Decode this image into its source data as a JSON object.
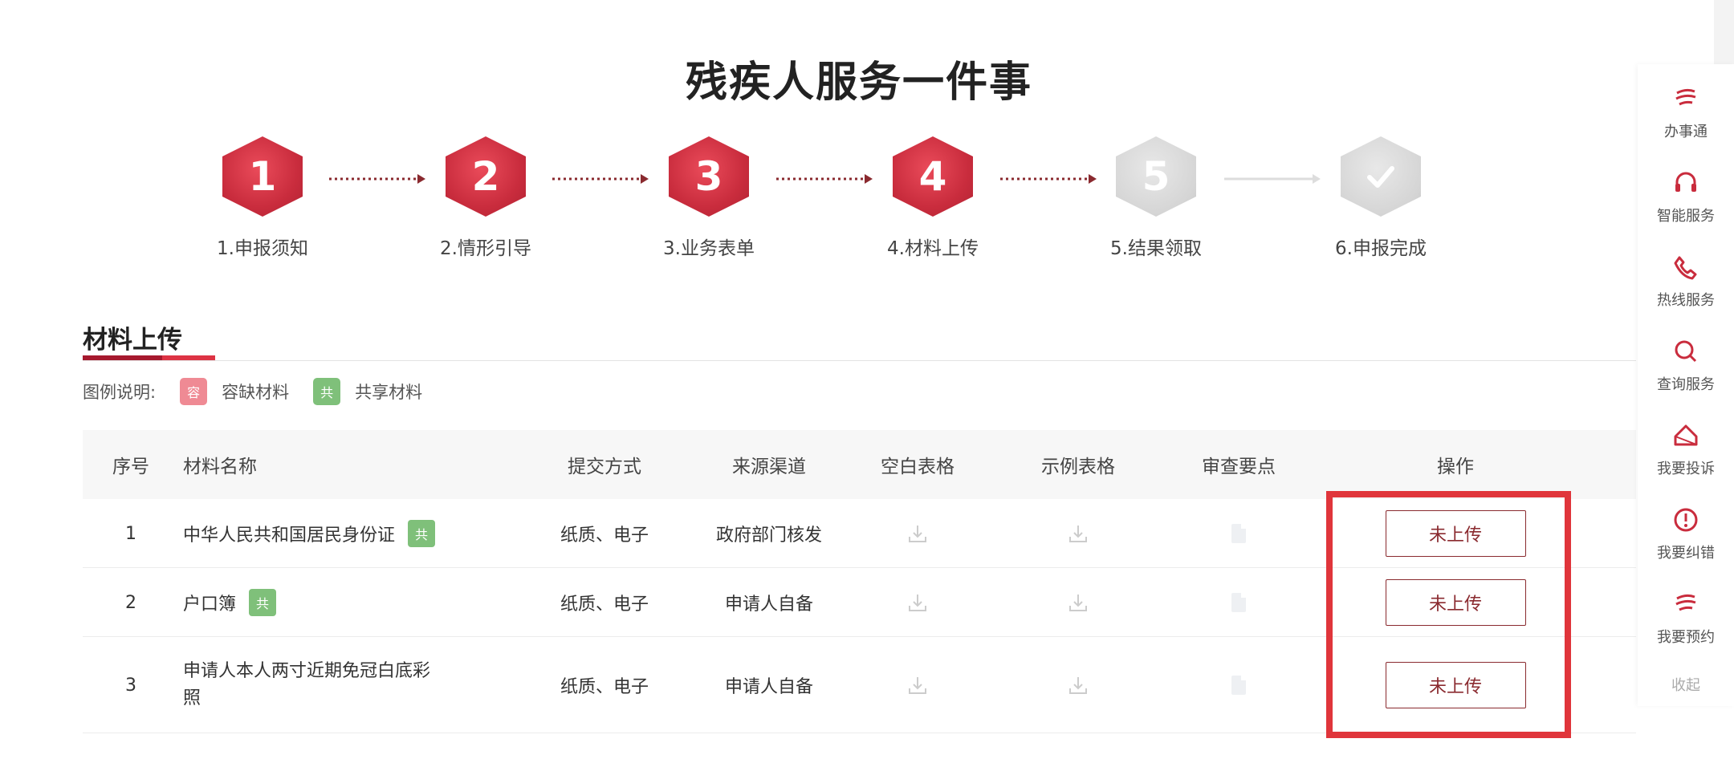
{
  "page": {
    "title": "残疾人服务一件事"
  },
  "steps": [
    {
      "number": "1",
      "label": "1.申报须知",
      "status": "done"
    },
    {
      "number": "2",
      "label": "2.情形引导",
      "status": "done"
    },
    {
      "number": "3",
      "label": "3.业务表单",
      "status": "done"
    },
    {
      "number": "4",
      "label": "4.材料上传",
      "status": "current"
    },
    {
      "number": "5",
      "label": "5.结果领取",
      "status": "pending"
    },
    {
      "number": "",
      "icon": "check-icon",
      "label": "6.申报完成",
      "status": "pending"
    }
  ],
  "section": {
    "title": "材料上传"
  },
  "legend": {
    "prefix": "图例说明:",
    "items": [
      {
        "badge": "容",
        "label": "容缺材料",
        "color": "#ef8a94"
      },
      {
        "badge": "共",
        "label": "共享材料",
        "color": "#7fc07a"
      }
    ]
  },
  "table": {
    "headers": {
      "no": "序号",
      "name": "材料名称",
      "submit": "提交方式",
      "source": "来源渠道",
      "blank": "空白表格",
      "sample": "示例表格",
      "review": "审查要点",
      "op": "操作"
    },
    "rows": [
      {
        "no": "1",
        "name": "中华人民共和国居民身份证",
        "shared_badge": "共",
        "submit": "纸质、电子",
        "source": "政府部门核发",
        "op": "未上传"
      },
      {
        "no": "2",
        "name": "户口簿",
        "shared_badge": "共",
        "submit": "纸质、电子",
        "source": "申请人自备",
        "op": "未上传"
      },
      {
        "no": "3",
        "name_line1": "申请人本人两寸近期免冠白底彩",
        "name_line2": "照",
        "submit": "纸质、电子",
        "source": "申请人自备",
        "op": "未上传"
      }
    ]
  },
  "sidebar": {
    "items": [
      {
        "icon": "banshitong-logo-icon",
        "label": "办事通"
      },
      {
        "icon": "headset-icon",
        "label": "智能服务"
      },
      {
        "icon": "phone-icon",
        "label": "热线服务"
      },
      {
        "icon": "search-icon",
        "label": "查询服务"
      },
      {
        "icon": "complaint-icon",
        "label": "我要投诉"
      },
      {
        "icon": "alert-icon",
        "label": "我要纠错"
      },
      {
        "icon": "appointment-logo-icon",
        "label": "我要预约"
      }
    ],
    "collapse": "收起"
  },
  "colors": {
    "accent": "#c92c3d",
    "button_text": "#8a2a2f",
    "highlight": "#e0353b",
    "share_green": "#7fc07a"
  }
}
